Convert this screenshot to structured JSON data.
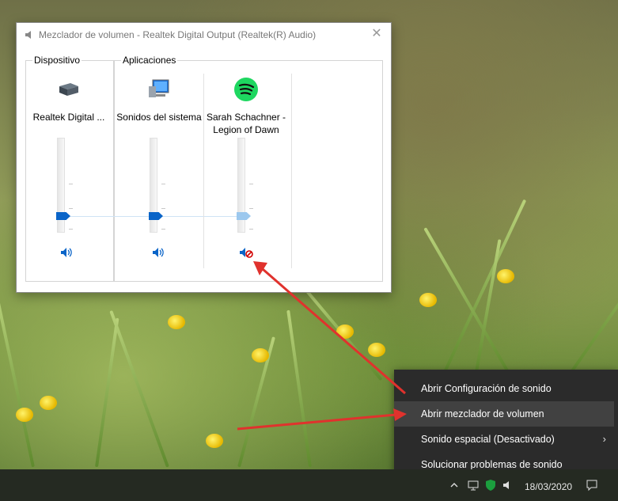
{
  "mixer": {
    "title": "Mezclador de volumen - Realtek Digital Output (Realtek(R) Audio)",
    "close_symbol": "✕",
    "device_group_label": "Dispositivo",
    "apps_group_label": "Aplicaciones",
    "device": {
      "name": "Realtek Digital ...",
      "icon": "audio-device-icon",
      "volume_percent": 15,
      "muted": false
    },
    "apps": [
      {
        "name": "Sonidos del sistema",
        "icon": "system-sounds-icon",
        "volume_percent": 15,
        "muted": false
      },
      {
        "name": "Sarah Schachner - Legion of Dawn",
        "icon": "spotify-icon",
        "volume_percent": 15,
        "muted": true
      }
    ],
    "accent_color": "#0a64c8"
  },
  "context_menu": {
    "items": [
      {
        "label": "Abrir Configuración de sonido",
        "highlighted": false
      },
      {
        "label": "Abrir mezclador de volumen",
        "highlighted": true
      },
      {
        "label": "Sonido espacial (Desactivado)",
        "highlighted": false,
        "has_submenu": true
      },
      {
        "label": "Solucionar problemas de sonido",
        "highlighted": false
      }
    ],
    "submenu_arrow": "›"
  },
  "taskbar": {
    "date": "18/03/2020"
  },
  "annotation": {
    "color": "#e0322d"
  }
}
